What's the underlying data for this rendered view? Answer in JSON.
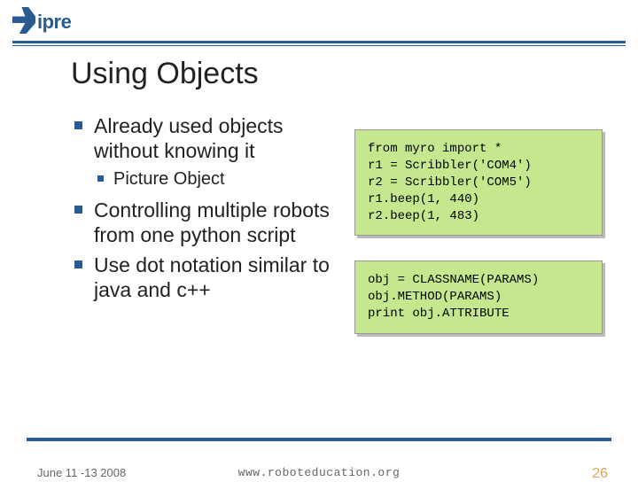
{
  "logo": {
    "text": "ipre"
  },
  "title": "Using Objects",
  "bullets": {
    "b1a": "Already used objects without knowing it",
    "b2a": "Picture Object",
    "b1b": "Controlling multiple robots from one python script",
    "b1c": "Use dot notation similar to java and c++"
  },
  "code1": "from myro import *\nr1 = Scribbler('COM4')\nr2 = Scribbler('COM5')\nr1.beep(1, 440)\nr2.beep(1, 483)",
  "code2": "obj = CLASSNAME(PARAMS)\nobj.METHOD(PARAMS)\nprint obj.ATTRIBUTE",
  "footer": {
    "date": "June 11 -13 2008",
    "url": "www.roboteducation.org",
    "page": "26"
  }
}
